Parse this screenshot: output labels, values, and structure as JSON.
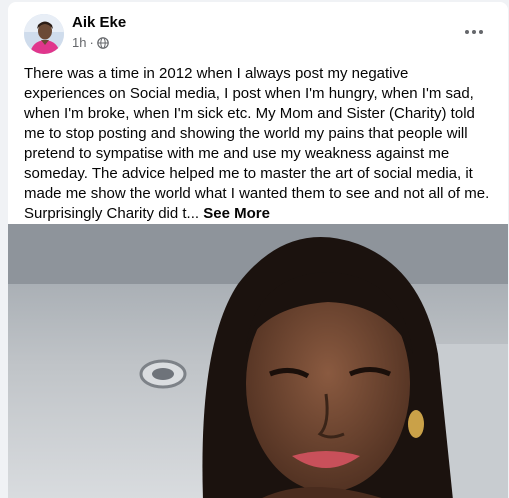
{
  "post": {
    "author": "Aik Eke",
    "time": "1h",
    "separator": "·",
    "body": "There was a time in 2012 when I always post my negative experiences on Social media, I post when I'm hungry, when I'm sad, when I'm broke, when I'm sick etc. My Mom and Sister (Charity) told me to stop posting and showing the world my pains that people will pretend to sympatise with me and use my weakness against me someday. The advice helped me to master the art of social media, it made me show the world what I wanted them to see and not all of me. Surprisingly Charity did t...",
    "see_more": "See More",
    "privacy_icon": "globe-icon",
    "menu_icon": "more-horizontal-icon"
  },
  "colors": {
    "background": "#f0f2f5",
    "card": "#ffffff",
    "text": "#050505",
    "secondary_text": "#65676b"
  }
}
